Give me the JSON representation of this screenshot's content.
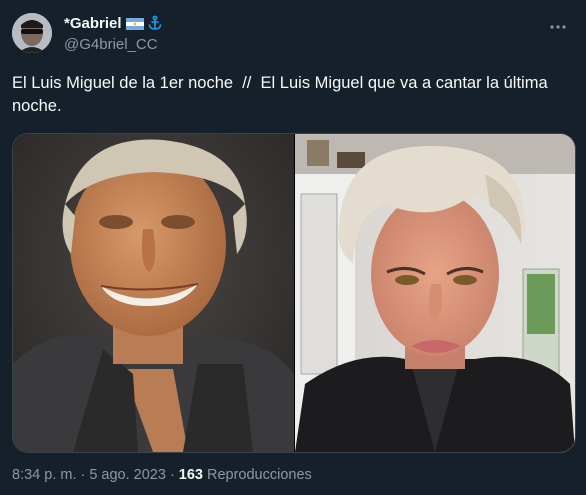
{
  "tweet": {
    "display_name": "*Gabriel",
    "handle": "@G4briel_CC",
    "flag_icon": "argentina-flag-icon",
    "badge_icon": "anchor-icon",
    "text": "El Luis Miguel de la 1er noche  //  El Luis Miguel que va a cantar la última noche.",
    "time": "8:34 p. m.",
    "separator": "·",
    "date": "5 ago. 2023",
    "views_count": "163",
    "views_label": "Reproducciones"
  },
  "colors": {
    "background": "#15202b",
    "text": "#f7f9f9",
    "secondary_text": "#8b98a5",
    "border": "#38444d",
    "accent": "#1d9bf0"
  }
}
